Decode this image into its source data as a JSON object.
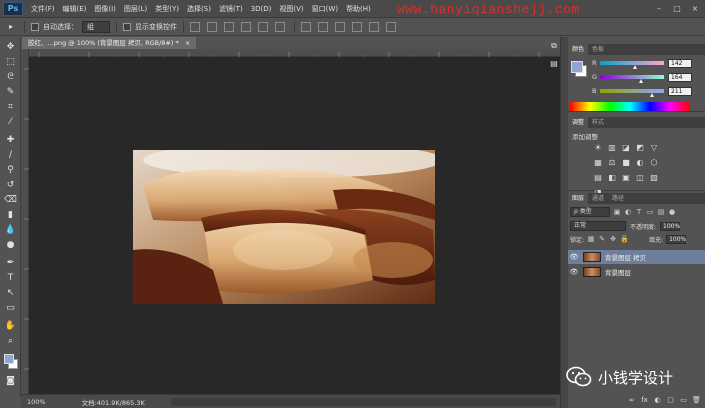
{
  "app": {
    "logo": "Ps",
    "menus": [
      "文件(F)",
      "编辑(E)",
      "图像(I)",
      "图层(L)",
      "类型(Y)",
      "选择(S)",
      "滤镜(T)",
      "3D(D)",
      "视图(V)",
      "窗口(W)",
      "帮助(H)"
    ],
    "watermark": "www.hanyiqianshejj.com",
    "window_controls": [
      "–",
      "□",
      "×"
    ]
  },
  "options_bar": {
    "tool_glyph": "▸",
    "auto_select_label": "自动选择：",
    "auto_select_value": "组",
    "show_transform_label": "显示变换控件"
  },
  "document": {
    "tab_title": "胶红、...png @ 100% (背景图层 拷贝, RGB/8#) *",
    "close_glyph": "×"
  },
  "status": {
    "zoom": "100%",
    "doc_info": "文档:401.9K/865.3K"
  },
  "color_panel": {
    "tabs": [
      "颜色",
      "色板"
    ],
    "sliders": [
      {
        "label": "R",
        "value": "142",
        "fraction": 0.557
      },
      {
        "label": "G",
        "value": "164",
        "fraction": 0.643
      },
      {
        "label": "B",
        "value": "211",
        "fraction": 0.827
      }
    ],
    "fg_color": "#8ea4d3",
    "bg_color": "#ffffff"
  },
  "adjustments_panel": {
    "tabs": [
      "调整",
      "样式"
    ],
    "title": "添加调整",
    "icons": [
      "☀",
      "▥",
      "◪",
      "◩",
      "▽",
      "▦",
      "⚖",
      "■",
      "◐",
      "⬡",
      "▤",
      "◧",
      "▣",
      "◫",
      "▨",
      "◨"
    ]
  },
  "layers_panel": {
    "tabs": [
      "图层",
      "通道",
      "路径"
    ],
    "filter_value": "ρ 类型",
    "blend_mode": "正常",
    "opacity_label": "不透明度:",
    "opacity_value": "100%",
    "lock_label": "锁定:",
    "fill_label": "填充:",
    "fill_value": "100%",
    "layers": [
      {
        "name": "背景图层 拷贝",
        "selected": true
      },
      {
        "name": "背景图层",
        "selected": false
      }
    ],
    "bottom_icons": [
      "∞",
      "fx",
      "◐",
      "▢",
      "▭",
      "🗑"
    ]
  },
  "watermark_brand": {
    "text": "小钱学设计"
  }
}
